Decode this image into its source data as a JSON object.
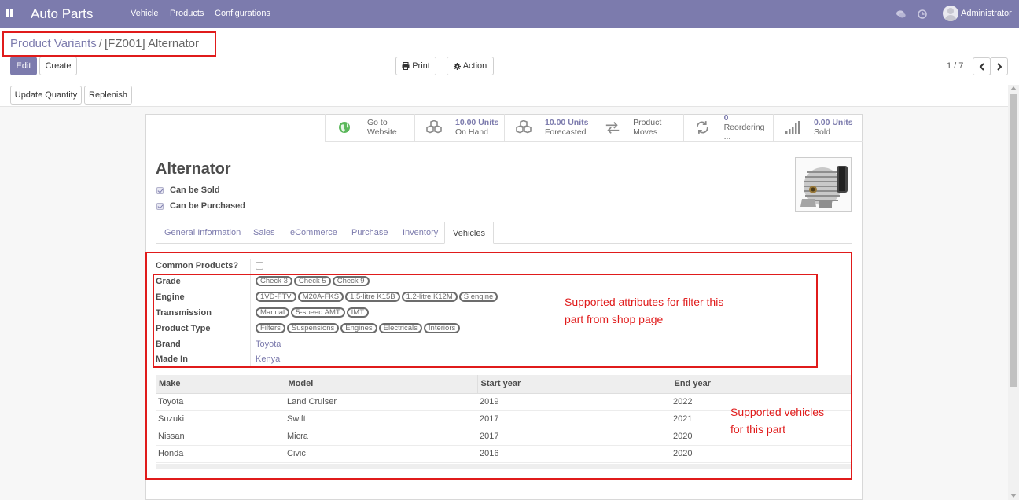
{
  "navbar": {
    "app_name": "Auto Parts",
    "menu": [
      "Vehicle",
      "Products",
      "Configurations"
    ],
    "user": "Administrator",
    "bg_color": "#7c7bad"
  },
  "breadcrumb": {
    "parent": "Product Variants",
    "separator": "/",
    "current": "[FZ001] Alternator"
  },
  "control": {
    "edit": "Edit",
    "create": "Create",
    "print": "Print",
    "action": "Action",
    "pager": "1 / 7",
    "update_quantity": "Update Quantity",
    "replenish": "Replenish"
  },
  "smart_buttons": [
    {
      "line1": "Go to",
      "line2": "Website",
      "icon": "globe-icon"
    },
    {
      "line1": "10.00 Units",
      "line2": "On Hand",
      "icon": "cubes-icon"
    },
    {
      "line1": "10.00 Units",
      "line2": "Forecasted",
      "icon": "cubes-icon"
    },
    {
      "line1": "Product Moves",
      "line2": "",
      "icon": "exchange-icon"
    },
    {
      "line1": "0",
      "line2": "Reordering ...",
      "icon": "refresh-icon"
    },
    {
      "line1": "0.00 Units",
      "line2": "Sold",
      "icon": "signal-icon"
    }
  ],
  "product": {
    "name": "Alternator",
    "can_be_sold": "Can be Sold",
    "can_be_purchased": "Can be Purchased"
  },
  "tabs": [
    "General Information",
    "Sales",
    "eCommerce",
    "Purchase",
    "Inventory",
    "Vehicles"
  ],
  "active_tab": "Vehicles",
  "fields": {
    "common_products": {
      "label": "Common Products?",
      "checked": false
    },
    "grade": {
      "label": "Grade",
      "tags": [
        "Check 3",
        "Check 5",
        "Check 9"
      ]
    },
    "engine": {
      "label": "Engine",
      "tags": [
        "1VD-FTV",
        "M20A-FKS",
        "1.5-litre K15B",
        "1.2-litre K12M",
        "S engine"
      ]
    },
    "transmission": {
      "label": "Transmission",
      "tags": [
        "Manual",
        "5-speed AMT",
        "IMT"
      ]
    },
    "product_type": {
      "label": "Product Type",
      "tags": [
        "Filters",
        "Suspensions",
        "Engines",
        "Electricals",
        "Interiors"
      ]
    },
    "brand": {
      "label": "Brand",
      "value": "Toyota"
    },
    "made_in": {
      "label": "Made In",
      "value": "Kenya"
    }
  },
  "annotations": {
    "attributes": [
      "Supported attributes for filter this",
      "part from shop page"
    ],
    "vehicles": [
      "Supported vehicles",
      "for this part"
    ]
  },
  "vehicles_table": {
    "columns": [
      "Make",
      "Model",
      "Start year",
      "End year"
    ],
    "rows": [
      [
        "Toyota",
        "Land Cruiser",
        "2019",
        "2022"
      ],
      [
        "Suzuki",
        "Swift",
        "2017",
        "2021"
      ],
      [
        "Nissan",
        "Micra",
        "2017",
        "2020"
      ],
      [
        "Honda",
        "Civic",
        "2016",
        "2020"
      ]
    ]
  }
}
